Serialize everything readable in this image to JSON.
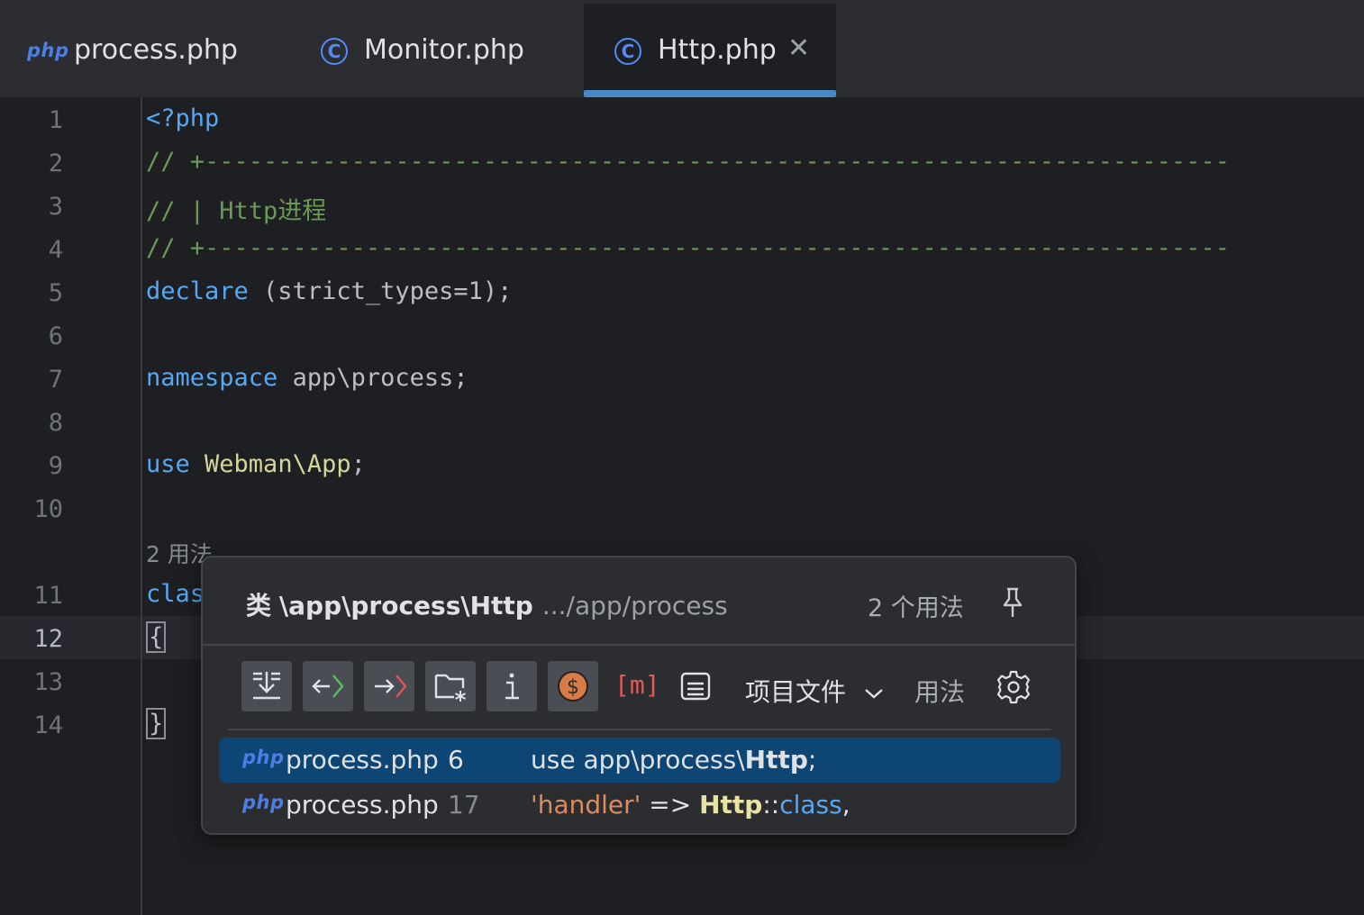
{
  "tabs": [
    {
      "label": "process.php",
      "icon": "php-file-icon",
      "active": false
    },
    {
      "label": "Monitor.php",
      "icon": "class-icon",
      "active": false
    },
    {
      "label": "Http.php",
      "icon": "class-icon",
      "active": true
    }
  ],
  "tab_icons": {
    "php": "php",
    "class": "C"
  },
  "editor": {
    "line_numbers": [
      "1",
      "2",
      "3",
      "4",
      "5",
      "6",
      "7",
      "8",
      "9",
      "10",
      "11",
      "12",
      "13",
      "14"
    ],
    "lines": {
      "l1": "<?php",
      "l2": "// +----------------------------------------------------------------------",
      "l3": "// | Http进程",
      "l4": "// +----------------------------------------------------------------------",
      "l5_kw": "declare",
      "l5_rest": " (strict_types=1);",
      "l7_kw": "namespace",
      "l7_rest": " app\\process;",
      "l9_kw": "use",
      "l9_type": " Webman\\App",
      "l9_semi": ";",
      "l11_partial": "clas",
      "l12": "{",
      "l14": "}"
    },
    "inlay_hint": "2 用法"
  },
  "popup": {
    "kind": "类",
    "class_path": "\\app\\process\\Http",
    "location": ".../app/process",
    "usage_count": "2 个用法",
    "toolbar": {
      "scope": "项目文件",
      "usages": "用法",
      "method_icon_text": "[m]"
    },
    "results": [
      {
        "file": "process.php",
        "line": "6",
        "pre": "use app\\process\\",
        "match": "Http",
        "post": ";",
        "selected": true
      },
      {
        "file": "process.php",
        "line": "17",
        "str": "'handler'",
        "op": " => ",
        "match": "Http",
        "sep": "::",
        "kw": "class",
        "end": ",",
        "selected": false
      }
    ]
  },
  "colors": {
    "background": "#1e1f22",
    "keyword": "#56a8f5",
    "comment": "#6a9a55",
    "selection": "#0d4574",
    "tab_underline": "#4a88c7"
  }
}
